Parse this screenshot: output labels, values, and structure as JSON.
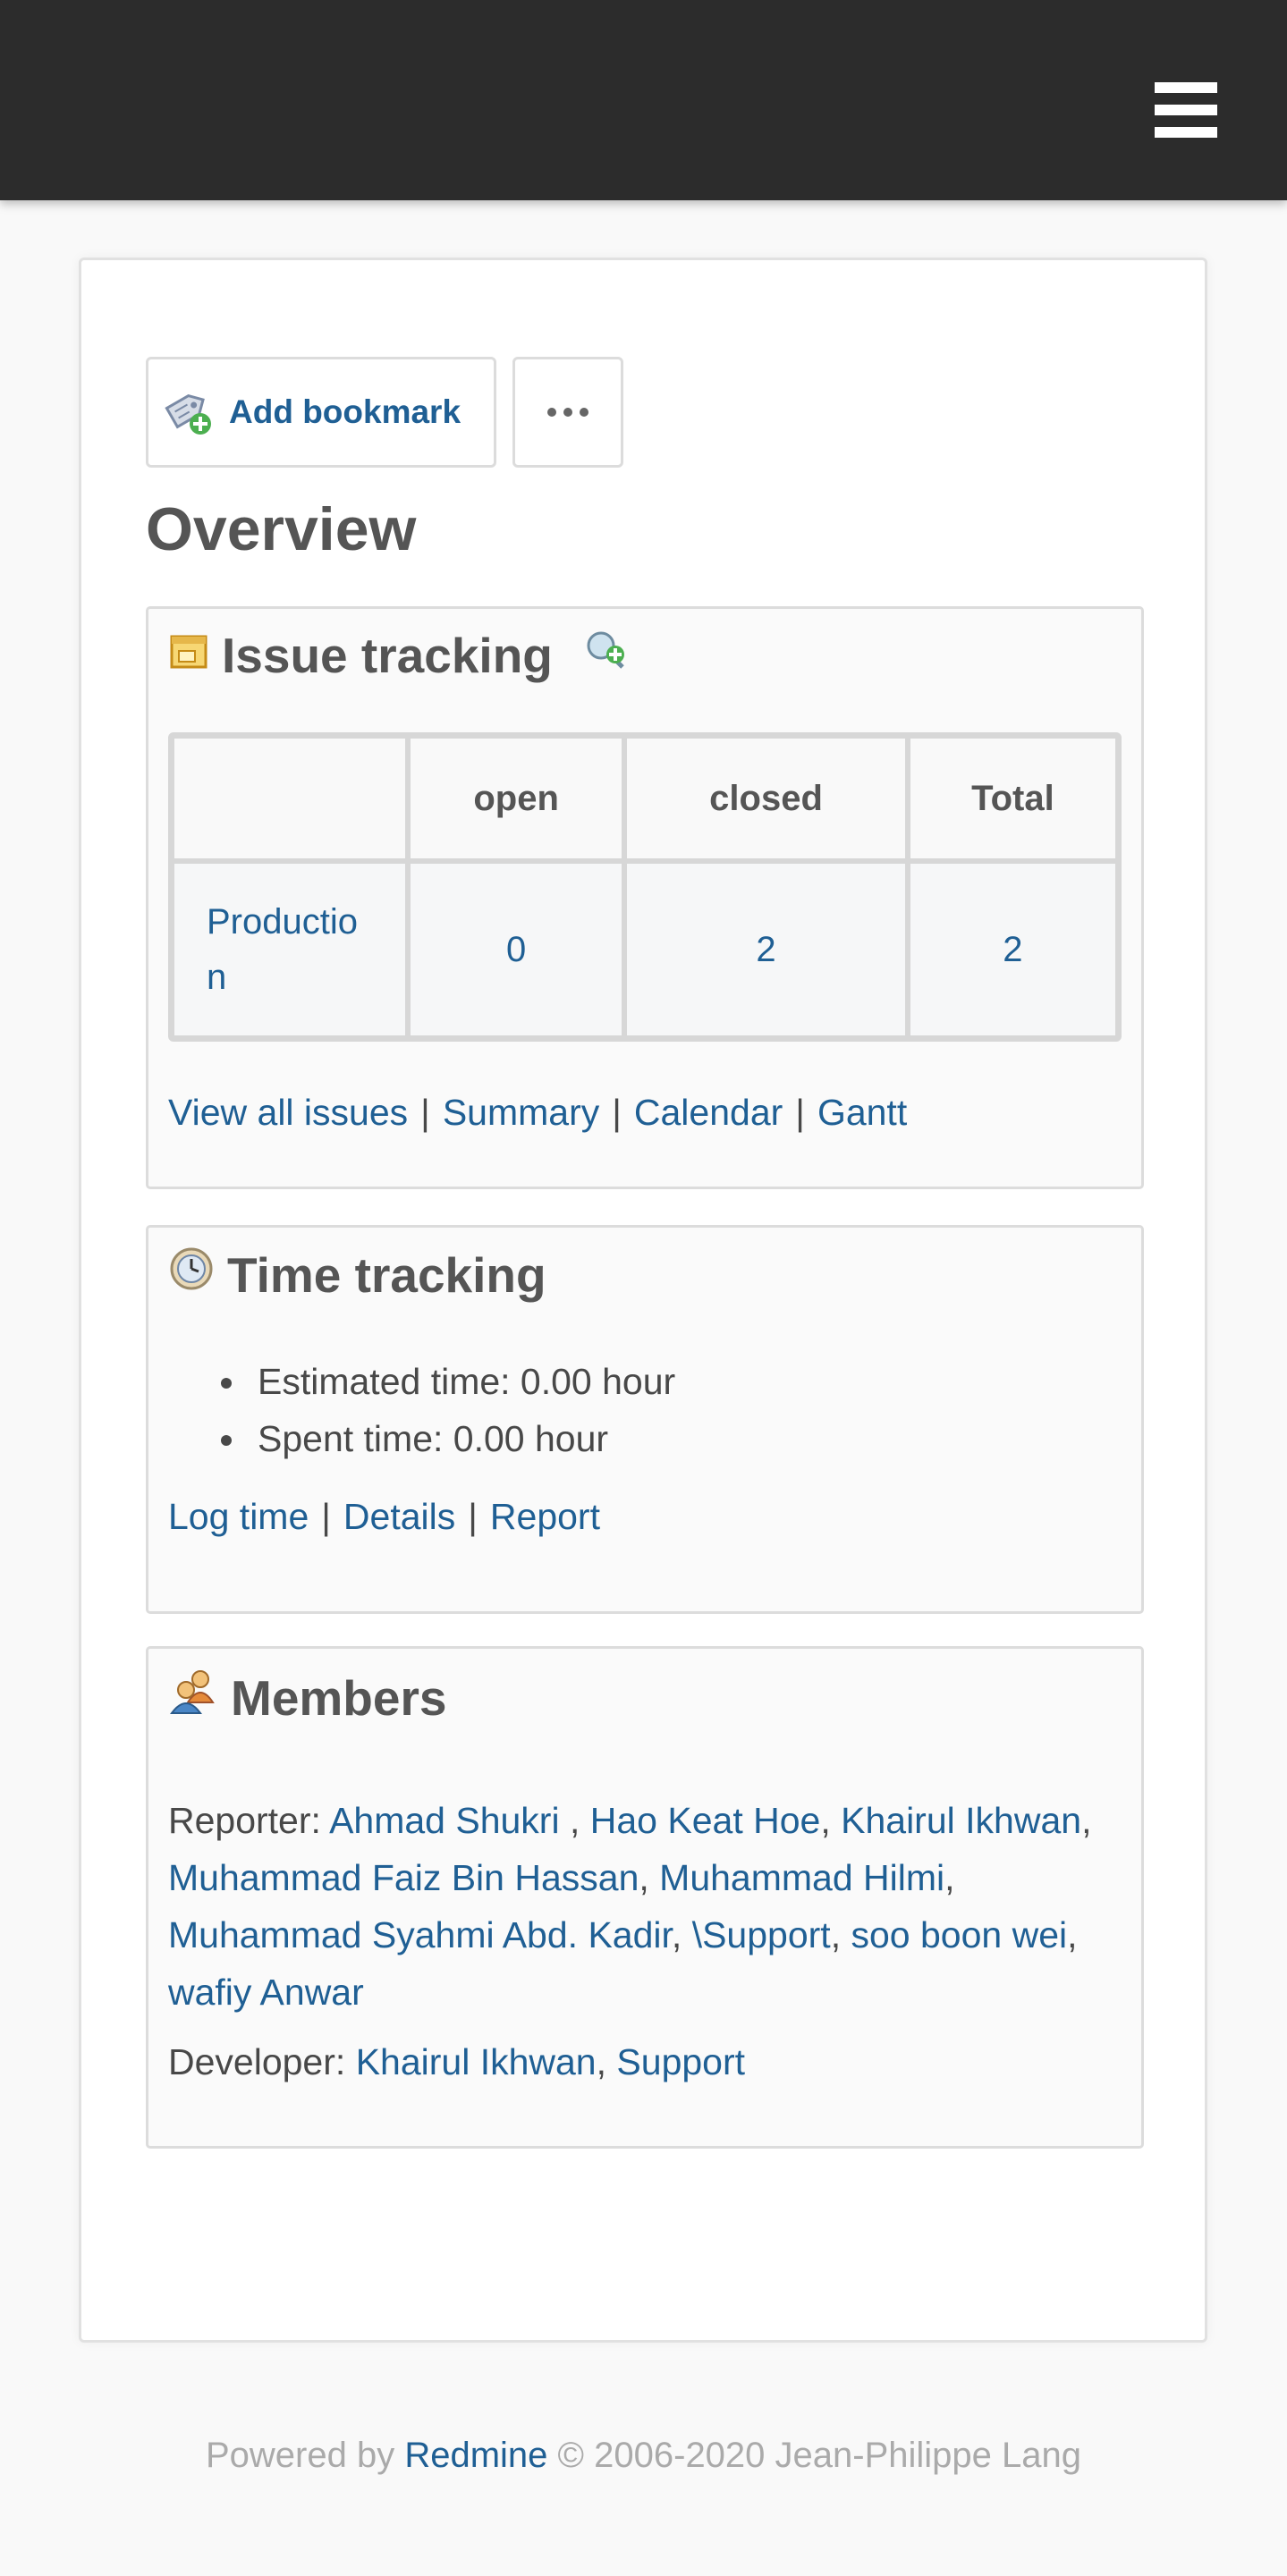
{
  "header": {
    "menu_icon": "hamburger-menu-icon"
  },
  "toolbar": {
    "bookmark_label": "Add bookmark",
    "bookmark_icon": "bookmark-add-icon",
    "more_icon": "ellipsis-icon"
  },
  "page": {
    "title": "Overview"
  },
  "issue_tracking": {
    "title": "Issue tracking",
    "icon": "issue-tracking-icon",
    "add_icon": "magnifier-add-icon",
    "columns": [
      "",
      "open",
      "closed",
      "Total"
    ],
    "rows": [
      {
        "tracker": "Production",
        "open": "0",
        "closed": "2",
        "total": "2"
      }
    ],
    "links": [
      "View all issues",
      "Summary",
      "Calendar",
      "Gantt"
    ],
    "separator": "|"
  },
  "time_tracking": {
    "title": "Time tracking",
    "icon": "clock-icon",
    "items": [
      "Estimated time: 0.00 hour",
      "Spent time: 0.00 hour"
    ],
    "links": [
      "Log time",
      "Details",
      "Report"
    ],
    "separator": "|"
  },
  "members": {
    "title": "Members",
    "icon": "group-icon",
    "reporter_label": "Reporter:",
    "reporters": [
      "Ahmad Shukri ",
      "Hao Keat Hoe",
      "Khairul Ikhwan",
      "Muhammad Faiz Bin Hassan",
      "Muhammad Hilmi",
      "Muhammad Syahmi Abd. Kadir",
      "\\Support",
      "soo boon wei",
      "wafiy Anwar"
    ],
    "developer_label": "Developer:",
    "developers": [
      "Khairul Ikhwan",
      "Support"
    ]
  },
  "footer": {
    "prefix": "Powered by",
    "link": "Redmine",
    "suffix": "© 2006-2020 Jean-Philippe Lang"
  },
  "colors": {
    "header_bg": "#2c2c2c",
    "link": "#1f5f94",
    "text": "#484848"
  }
}
